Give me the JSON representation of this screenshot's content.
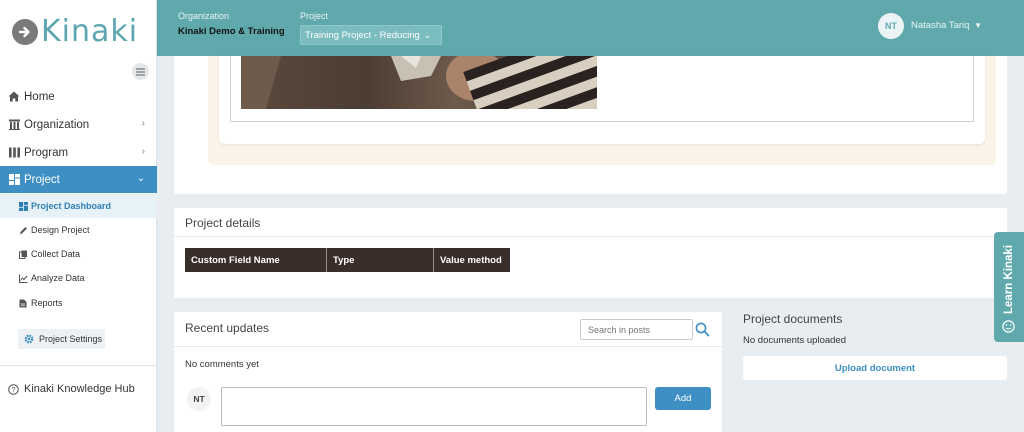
{
  "app": {
    "logo_text": "Kinaki",
    "logo_icon": "arrow-right-circle-icon"
  },
  "header": {
    "organization_label": "Organization",
    "organization_value": "Kinaki Demo & Training",
    "project_label": "Project",
    "project_value": "Training Project - Reducing",
    "user_initials": "NT",
    "user_name": "Natasha Tariq"
  },
  "sidebar": {
    "items": [
      {
        "label": "Home",
        "icon": "home-icon"
      },
      {
        "label": "Organization",
        "icon": "building-icon"
      },
      {
        "label": "Program",
        "icon": "program-icon"
      },
      {
        "label": "Project",
        "icon": "dashboard-icon"
      }
    ],
    "subitems": [
      {
        "label": "Project Dashboard",
        "icon": "dashboard-icon"
      },
      {
        "label": "Design Project",
        "icon": "pencil-icon"
      },
      {
        "label": "Collect Data",
        "icon": "copy-icon"
      },
      {
        "label": "Analyze Data",
        "icon": "line-chart-icon"
      },
      {
        "label": "Reports",
        "icon": "file-icon"
      }
    ],
    "settings_label": "Project Settings",
    "hub_label": "Kinaki Knowledge Hub"
  },
  "details": {
    "title": "Project details",
    "columns": [
      "Custom Field Name",
      "Type",
      "Value method"
    ]
  },
  "updates": {
    "title": "Recent updates",
    "search_placeholder": "Search in posts",
    "no_comments": "No comments yet",
    "user_initials": "NT",
    "add_label": "Add"
  },
  "documents": {
    "title": "Project documents",
    "empty": "No documents uploaded",
    "upload_label": "Upload document"
  },
  "learn": {
    "label": "Learn Kinaki"
  },
  "colors": {
    "header": "#5fa9ad",
    "accent": "#3d8fc4",
    "table_header": "#3a2e2a"
  }
}
